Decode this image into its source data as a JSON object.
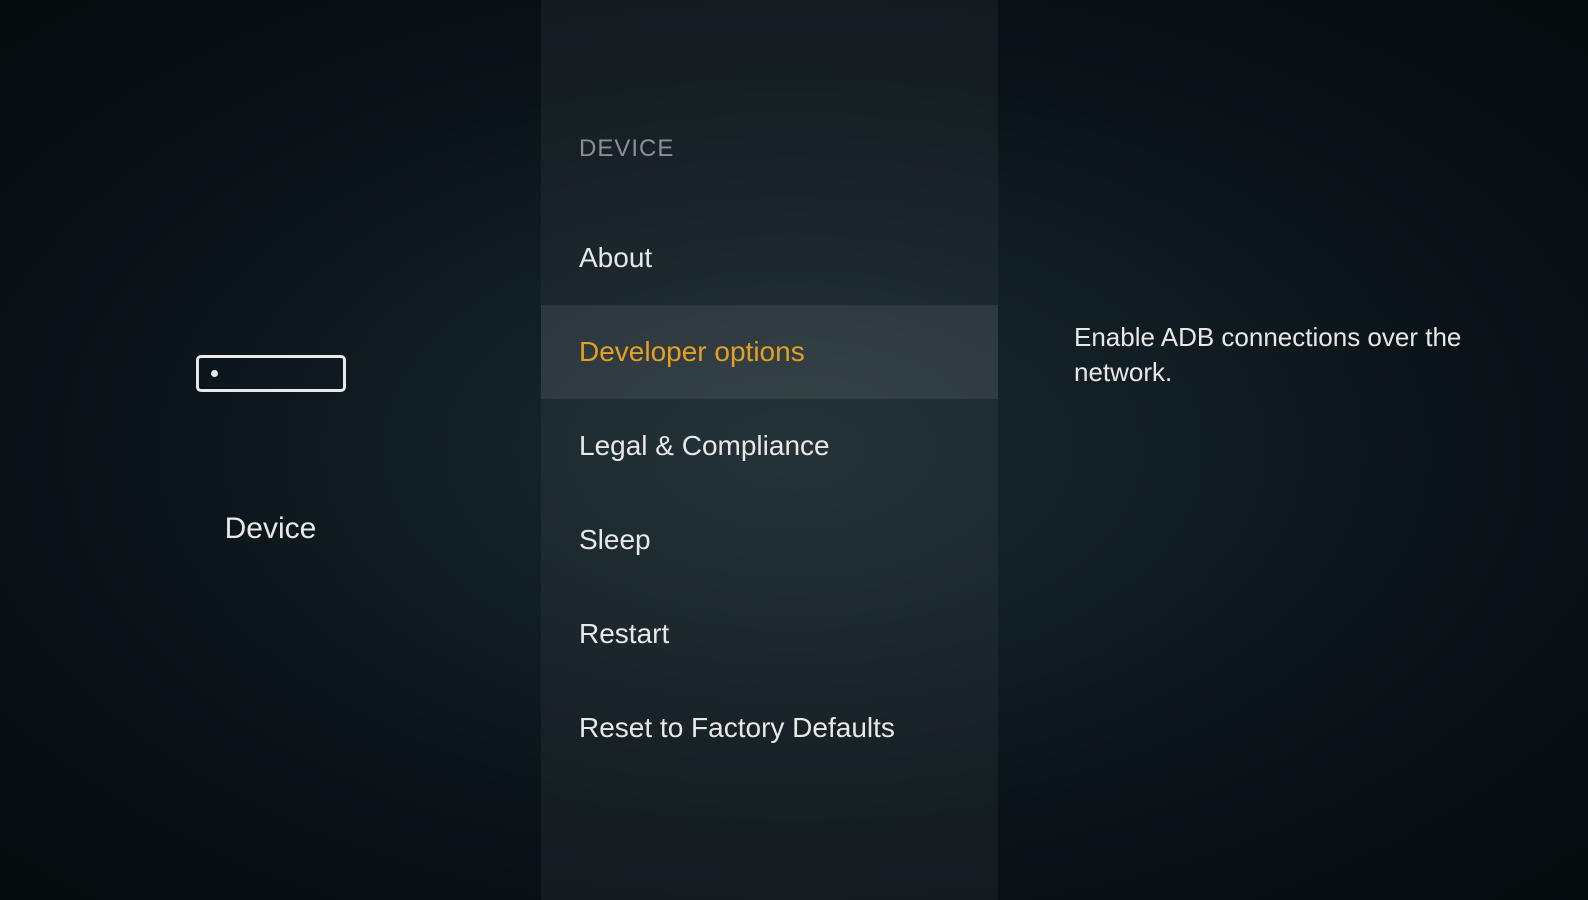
{
  "left": {
    "label": "Device"
  },
  "center": {
    "header": "DEVICE",
    "items": [
      {
        "label": "About",
        "selected": false
      },
      {
        "label": "Developer options",
        "selected": true
      },
      {
        "label": "Legal & Compliance",
        "selected": false
      },
      {
        "label": "Sleep",
        "selected": false
      },
      {
        "label": "Restart",
        "selected": false
      },
      {
        "label": "Reset to Factory Defaults",
        "selected": false
      }
    ]
  },
  "right": {
    "description": "Enable ADB connections over the network."
  }
}
